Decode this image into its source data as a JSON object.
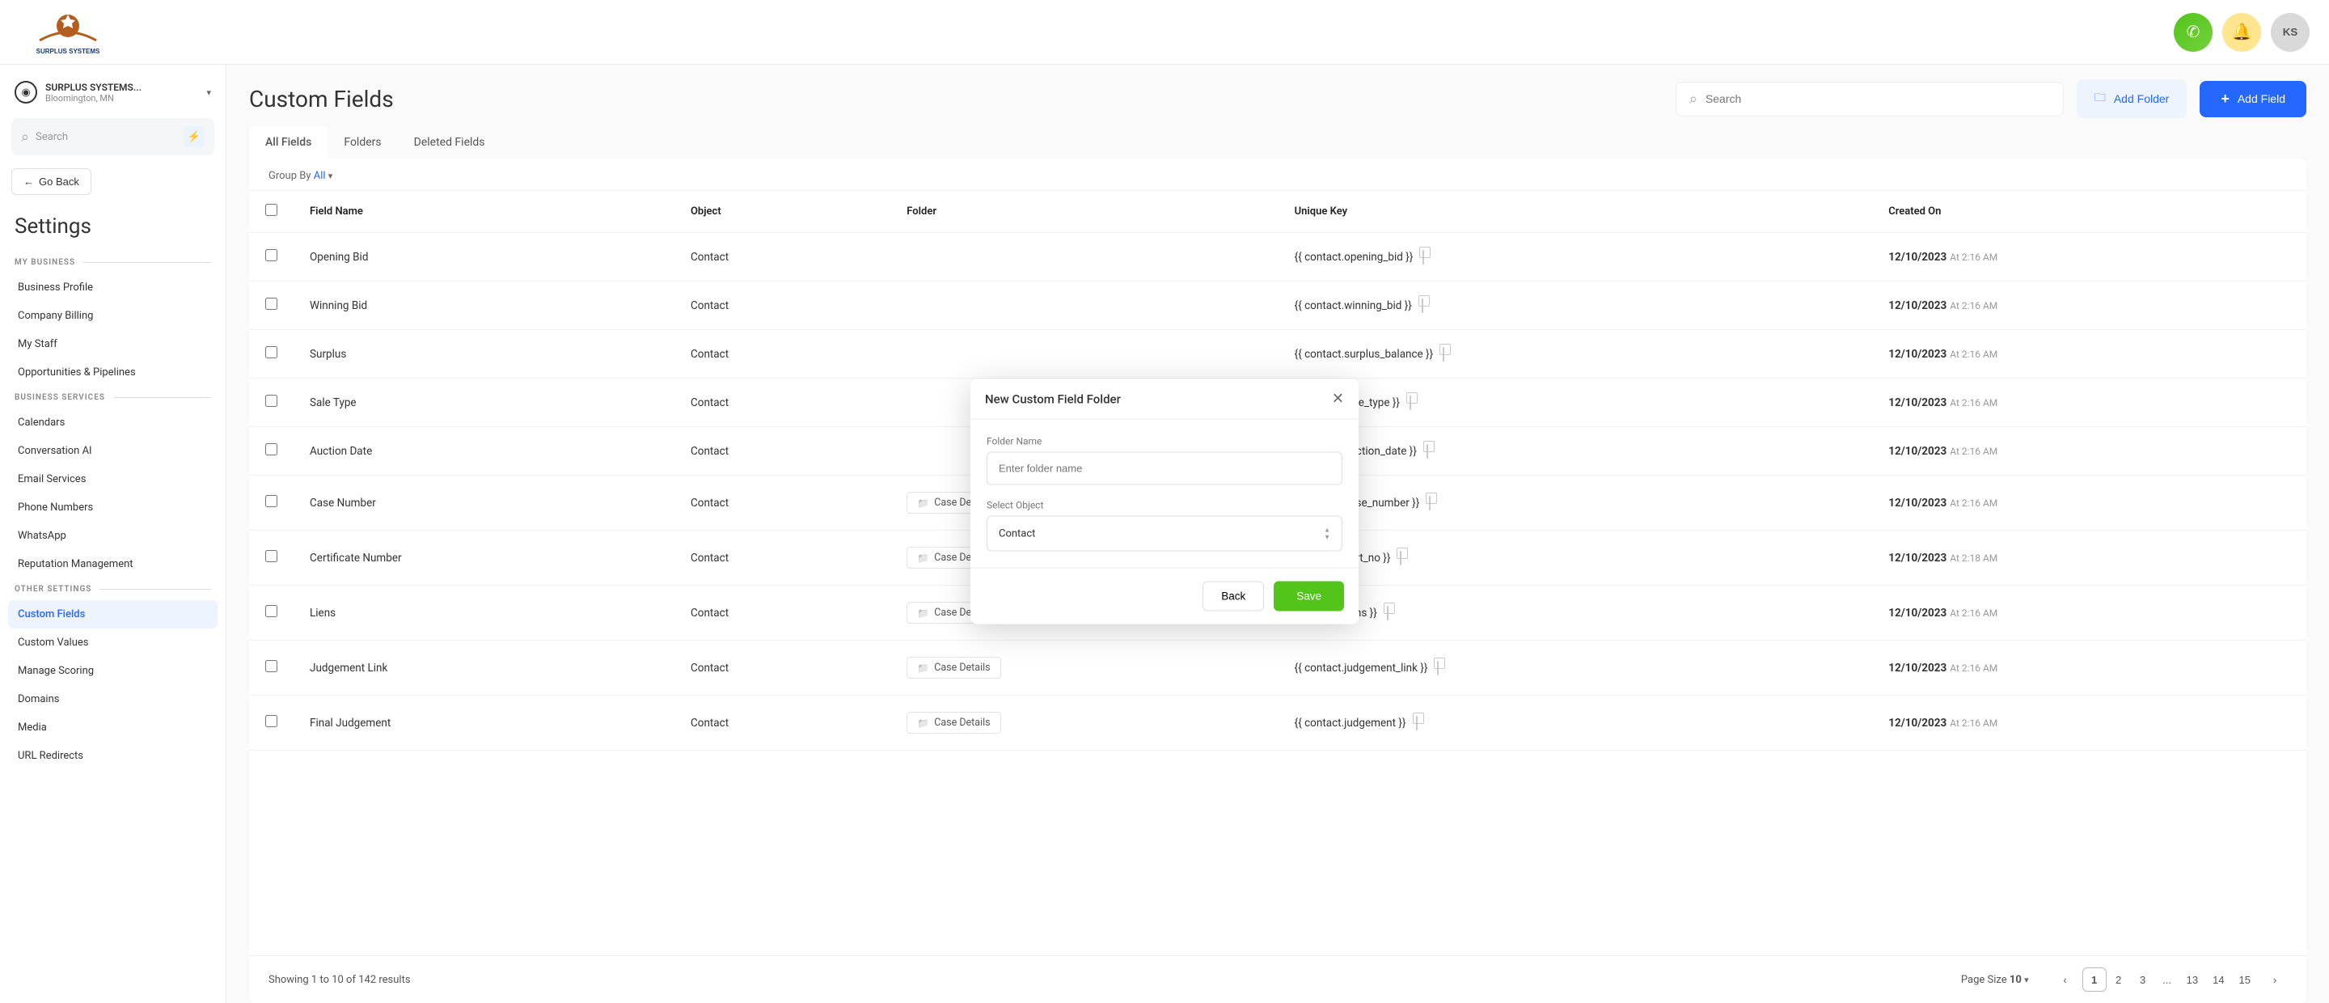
{
  "brand": {
    "name": "SURPLUS SYSTEMS",
    "logo_top": "⚙",
    "logo_color": "#b35e1e"
  },
  "header": {
    "avatar_initials": "KS"
  },
  "sidebar": {
    "location": {
      "name": "SURPLUS SYSTEMS...",
      "city": "Bloomington, MN"
    },
    "search_placeholder": "Search",
    "go_back": "Go Back",
    "title": "Settings",
    "sections": [
      {
        "title": "MY BUSINESS",
        "items": [
          {
            "key": "biz-profile",
            "label": "Business Profile"
          },
          {
            "key": "billing",
            "label": "Company Billing"
          },
          {
            "key": "staff",
            "label": "My Staff"
          },
          {
            "key": "pipelines",
            "label": "Opportunities & Pipelines"
          }
        ]
      },
      {
        "title": "BUSINESS SERVICES",
        "items": [
          {
            "key": "calendars",
            "label": "Calendars"
          },
          {
            "key": "ai",
            "label": "Conversation AI"
          },
          {
            "key": "email",
            "label": "Email Services"
          },
          {
            "key": "phone",
            "label": "Phone Numbers"
          },
          {
            "key": "whatsapp",
            "label": "WhatsApp"
          },
          {
            "key": "reputation",
            "label": "Reputation Management"
          }
        ]
      },
      {
        "title": "OTHER SETTINGS",
        "items": [
          {
            "key": "custom-fields",
            "label": "Custom Fields",
            "active": true
          },
          {
            "key": "custom-values",
            "label": "Custom Values"
          },
          {
            "key": "scoring",
            "label": "Manage Scoring"
          },
          {
            "key": "domains",
            "label": "Domains"
          },
          {
            "key": "media",
            "label": "Media"
          },
          {
            "key": "url",
            "label": "URL Redirects"
          }
        ]
      }
    ]
  },
  "main": {
    "title": "Custom Fields",
    "search_placeholder": "Search",
    "add_folder": "Add Folder",
    "add_field": "Add Field",
    "tabs": [
      {
        "key": "all",
        "label": "All Fields",
        "active": true
      },
      {
        "key": "folders",
        "label": "Folders"
      },
      {
        "key": "deleted",
        "label": "Deleted Fields"
      }
    ],
    "group_by_label": "Group By",
    "group_by_value": "All",
    "columns": [
      "Field Name",
      "Object",
      "Folder",
      "Unique Key",
      "Created On"
    ],
    "rows": [
      {
        "name": "Opening Bid",
        "object": "Contact",
        "folder": "",
        "key": "{{ contact.opening_bid }}",
        "date": "12/10/2023",
        "time": "At 2:16 AM"
      },
      {
        "name": "Winning Bid",
        "object": "Contact",
        "folder": "",
        "key": "{{ contact.winning_bid }}",
        "date": "12/10/2023",
        "time": "At 2:16 AM"
      },
      {
        "name": "Surplus",
        "object": "Contact",
        "folder": "",
        "key": "{{ contact.surplus_balance }}",
        "date": "12/10/2023",
        "time": "At 2:16 AM"
      },
      {
        "name": "Sale Type",
        "object": "Contact",
        "folder": "",
        "key": "{{ contact.sale_type }}",
        "date": "12/10/2023",
        "time": "At 2:16 AM"
      },
      {
        "name": "Auction Date",
        "object": "Contact",
        "folder": "",
        "key": "{{ contact.auction_date }}",
        "date": "12/10/2023",
        "time": "At 2:16 AM"
      },
      {
        "name": "Case Number",
        "object": "Contact",
        "folder": "Case Details",
        "key": "{{ contact.case_number }}",
        "date": "12/10/2023",
        "time": "At 2:16 AM"
      },
      {
        "name": "Certificate Number",
        "object": "Contact",
        "folder": "Case Details",
        "key": "{{ contact.cert_no }}",
        "date": "12/10/2023",
        "time": "At 2:18 AM"
      },
      {
        "name": "Liens",
        "object": "Contact",
        "folder": "Case Details",
        "key": "{{ contact.liens }}",
        "date": "12/10/2023",
        "time": "At 2:16 AM"
      },
      {
        "name": "Judgement Link",
        "object": "Contact",
        "folder": "Case Details",
        "key": "{{ contact.judgement_link }}",
        "date": "12/10/2023",
        "time": "At 2:16 AM"
      },
      {
        "name": "Final Judgement",
        "object": "Contact",
        "folder": "Case Details",
        "key": "{{ contact.judgement }}",
        "date": "12/10/2023",
        "time": "At 2:16 AM"
      }
    ],
    "footer": {
      "showing": "Showing 1 to 10 of 142 results",
      "page_size_label": "Page Size",
      "page_size": "10",
      "pages": [
        "1",
        "2",
        "3",
        "...",
        "13",
        "14",
        "15"
      ]
    }
  },
  "modal": {
    "title": "New Custom Field Folder",
    "folder_name_label": "Folder Name",
    "folder_name_placeholder": "Enter folder name",
    "select_object_label": "Select Object",
    "select_object_value": "Contact",
    "back": "Back",
    "save": "Save"
  }
}
